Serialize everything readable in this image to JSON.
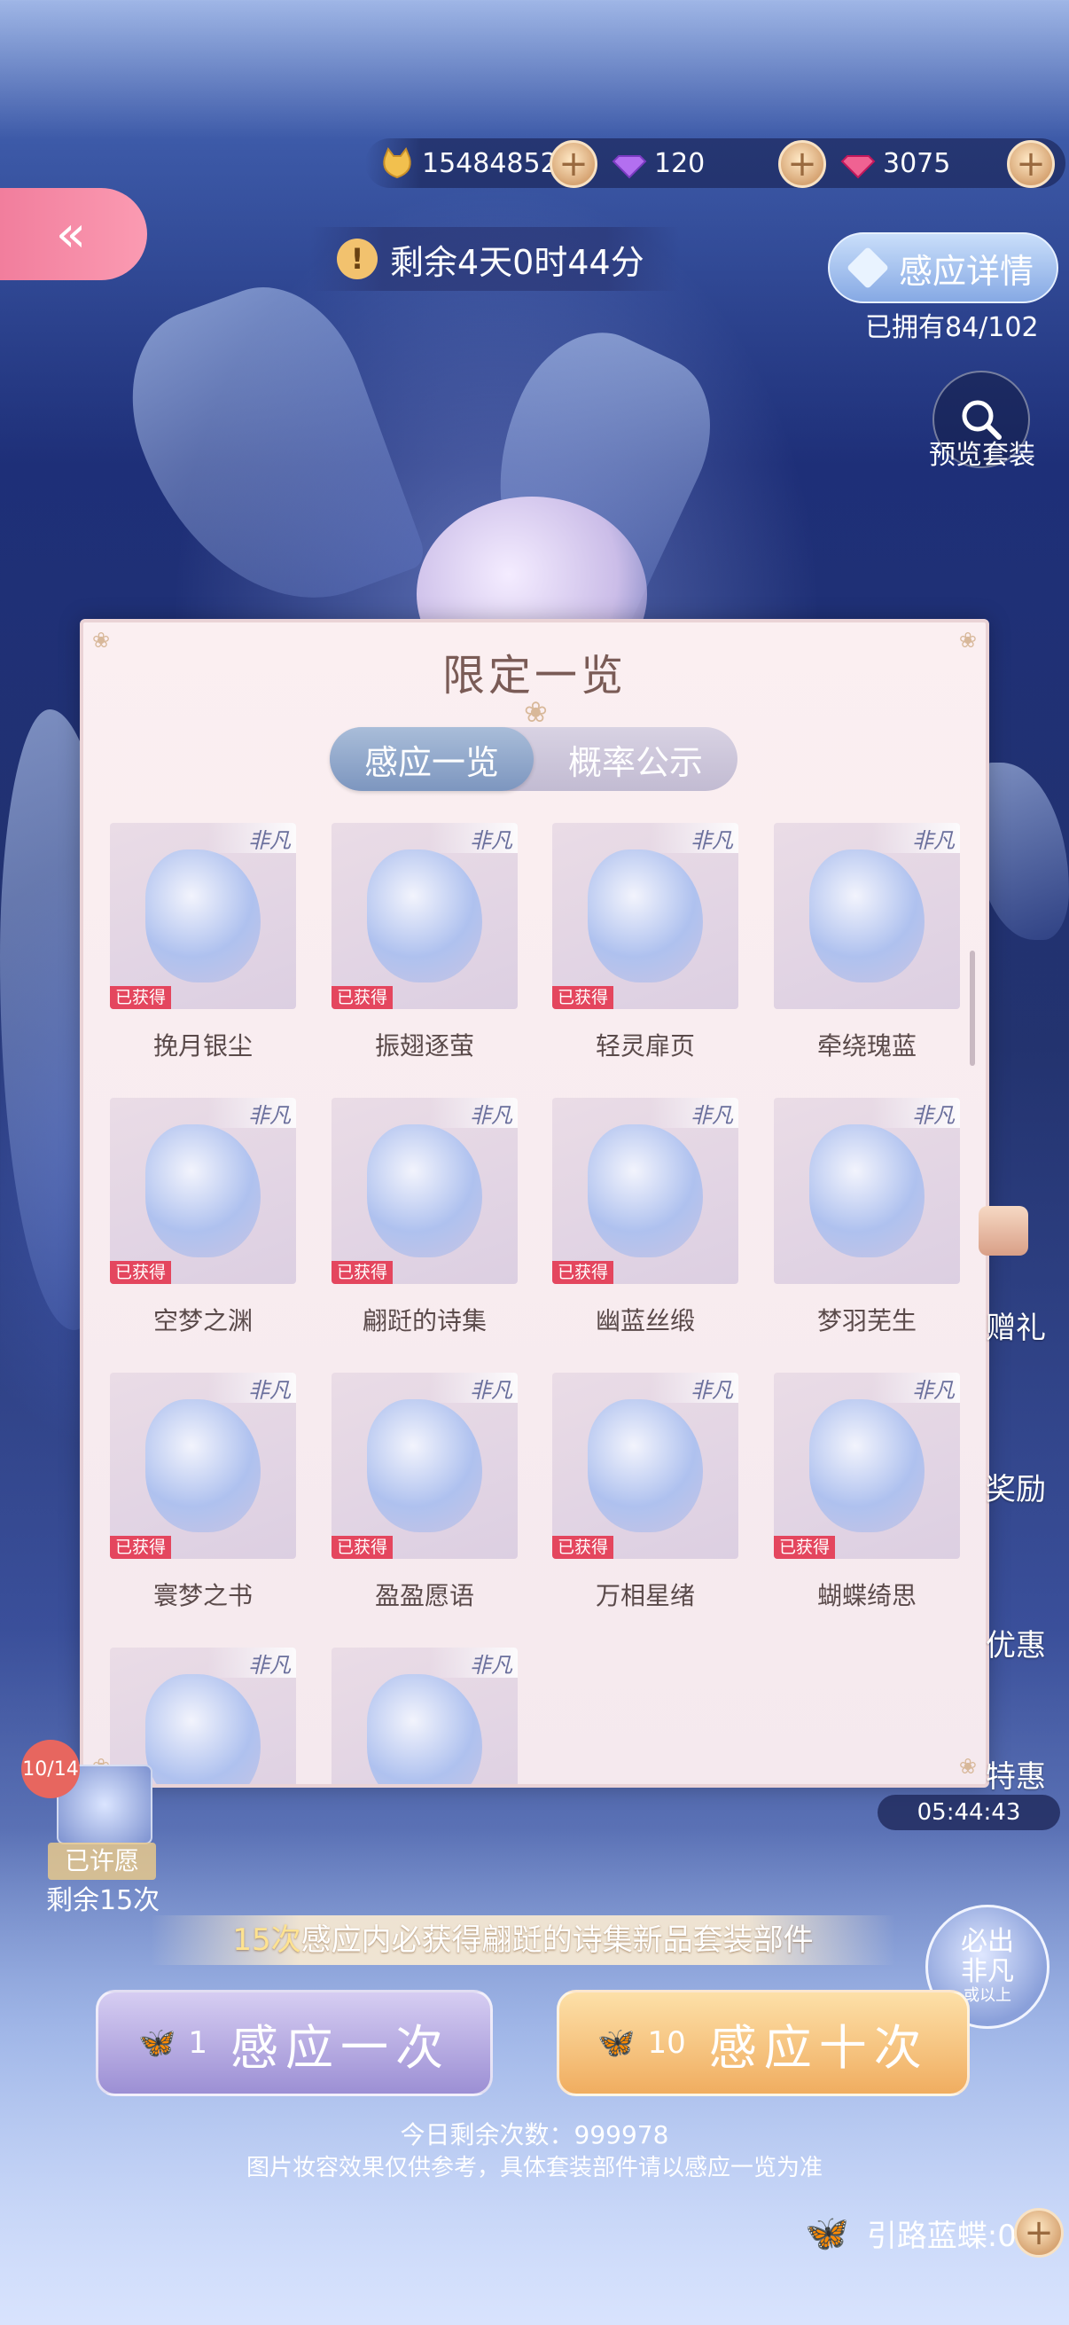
{
  "currency": {
    "coins": "15484852",
    "diamonds": "120",
    "pink_gems": "3075",
    "coin_color": "#f2c04e",
    "diamond_color": "#b36ff0",
    "pink_gem_color": "#f06292",
    "add_symbol": "+"
  },
  "back": {
    "symbol": "«"
  },
  "timer": {
    "icon": "!",
    "text": "剩余4天0时44分"
  },
  "detail": {
    "label": "感应详情",
    "owned": "已拥有84/102"
  },
  "preview": {
    "label": "预览套装"
  },
  "modal": {
    "title": "限定一览",
    "tabs": [
      {
        "label": "感应一览"
      },
      {
        "label": "概率公示"
      }
    ],
    "rarity_tag": "非凡",
    "owned_tag": "已获得",
    "items": [
      {
        "name": "挽月银尘"
      },
      {
        "name": "振翅逐萤"
      },
      {
        "name": "轻灵扉页"
      },
      {
        "name": "牵绕瑰蓝"
      },
      {
        "name": "空梦之渊"
      },
      {
        "name": "翩跹的诗集"
      },
      {
        "name": "幽蓝丝缎"
      },
      {
        "name": "梦羽芜生"
      },
      {
        "name": "寰梦之书"
      },
      {
        "name": "盈盈愿语"
      },
      {
        "name": "万相星绪"
      },
      {
        "name": "蝴蝶绮思"
      },
      {
        "name": ""
      },
      {
        "name": ""
      }
    ]
  },
  "wish": {
    "count": "10/14",
    "label": "已许愿",
    "remaining": "剩余15次"
  },
  "side": {
    "gift_label": "赠礼",
    "reward_label": "奖励",
    "discount_label": "优惠",
    "special_label": "特惠",
    "timer": "05:44:43"
  },
  "guarantee": {
    "highlight": "15次",
    "text": "感应内必获得翩跹的诗集新品套装部件",
    "badge_top": "必出",
    "badge_main": "非凡",
    "badge_sub": "或以上"
  },
  "draw": {
    "once": {
      "count": "1",
      "label": "感应一次"
    },
    "ten": {
      "count": "10",
      "label": "感应十次"
    }
  },
  "remain_today": "今日剩余次数：999978",
  "disclaimer": "图片妆容效果仅供参考，具体套装部件请以感应一览为准",
  "guide": {
    "label": "引路蓝蝶:0",
    "add_symbol": "+"
  }
}
